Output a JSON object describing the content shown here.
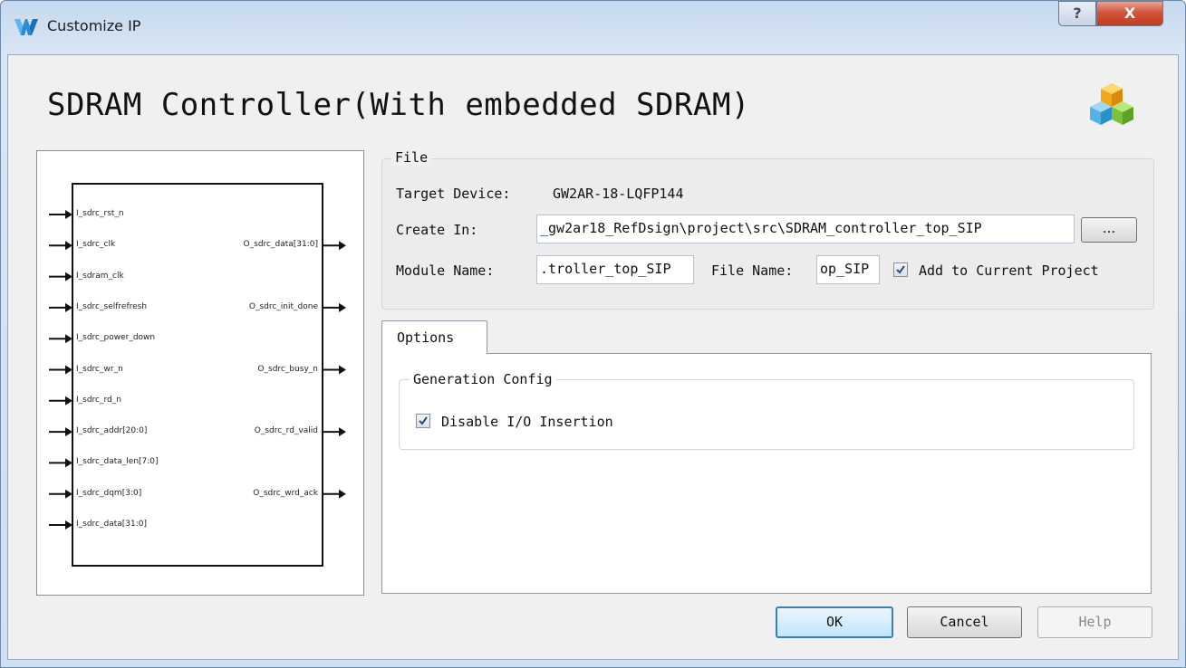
{
  "window": {
    "title": "Customize IP",
    "help_glyph": "?",
    "close_glyph": "X",
    "icon": "gowin-logo-icon"
  },
  "header": {
    "title": "SDRAM Controller(With embedded SDRAM)",
    "icon": "ip-cubes-icon"
  },
  "symbol": {
    "inputs": [
      "I_sdrc_rst_n",
      "I_sdrc_clk",
      "I_sdram_clk",
      "I_sdrc_selfrefresh",
      "I_sdrc_power_down",
      "I_sdrc_wr_n",
      "I_sdrc_rd_n",
      "I_sdrc_addr[20:0]",
      "I_sdrc_data_len[7:0]",
      "I_sdrc_dqm[3:0]",
      "I_sdrc_data[31:0]"
    ],
    "outputs": [
      "O_sdrc_data[31:0]",
      "O_sdrc_init_done",
      "O_sdrc_busy_n",
      "O_sdrc_rd_valid",
      "O_sdrc_wrd_ack"
    ]
  },
  "file": {
    "legend": "File",
    "target_device_label": "Target Device:",
    "target_device_value": "GW2AR-18-LQFP144",
    "create_in_label": "Create In:",
    "create_in_value": "_gw2ar18_RefDsign\\project\\src\\SDRAM_controller_top_SIP",
    "browse_label": "...",
    "module_name_label": "Module Name:",
    "module_name_value": ".troller_top_SIP",
    "file_name_label": "File Name:",
    "file_name_value": "op_SIP",
    "add_to_project_label": "Add to Current Project",
    "add_to_project_checked": true
  },
  "options": {
    "tab_label": "Options",
    "generation_legend": "Generation Config",
    "disable_io_label": "Disable I/O Insertion",
    "disable_io_checked": true
  },
  "buttons": {
    "ok": "OK",
    "cancel": "Cancel",
    "help": "Help"
  }
}
